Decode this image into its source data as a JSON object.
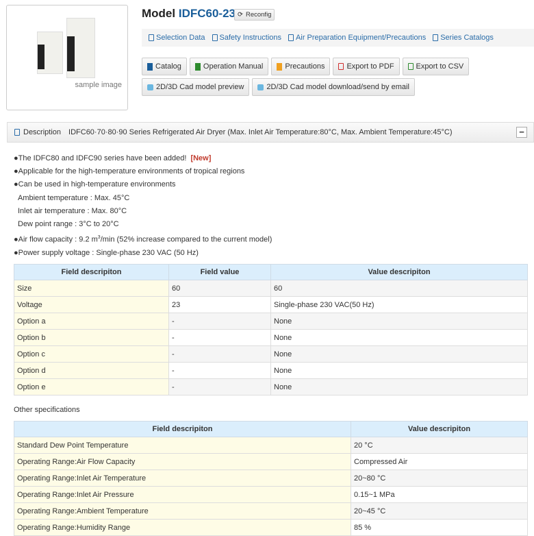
{
  "image": {
    "caption": "sample image"
  },
  "header": {
    "prefix": "Model",
    "model": "IDFC60-23",
    "reconfig": "Reconfig"
  },
  "links": [
    "Selection Data",
    "Safety Instructions",
    "Air Preparation Equipment/Precautions",
    "Series Catalogs"
  ],
  "buttons": {
    "catalog": "Catalog",
    "manual": "Operation Manual",
    "precautions": "Precautions",
    "pdf": "Export to PDF",
    "csv": "Export to CSV",
    "cad_preview": "2D/3D Cad model preview",
    "cad_download": "2D/3D Cad model download/send by email"
  },
  "colors": {
    "catalog": "#1a5e9a",
    "manual": "#2e8b2e",
    "precautions": "#f0a020",
    "pdf": "#d03030",
    "csv": "#2e8b2e"
  },
  "description": {
    "label": "Description",
    "text": "IDFC60·70·80·90 Series Refrigerated Air Dryer (Max. Inlet Air Temperature:80°C, Max. Ambient Temperature:45°C)",
    "collapse": "−",
    "line1": "●The IDFC80 and IDFC90 series have been added!",
    "new_badge": "[New]",
    "line2": "●Applicable for the high-temperature environments of tropical regions",
    "line3": "●Can be used in high-temperature environments",
    "line4": "Ambient temperature : Max. 45°C",
    "line5": "Inlet air temperature : Max. 80°C",
    "line6": "Dew point range : 3°C to 20°C",
    "line7a": "●Air flow capacity : 9.2 m",
    "line7sup": "3",
    "line7b": "/min (52% increase compared to the current model)",
    "line8": "●Power supply voltage : Single-phase 230 VAC (50 Hz)"
  },
  "table1": {
    "headers": [
      "Field descripiton",
      "Field value",
      "Value descripiton"
    ],
    "rows": [
      [
        "Size",
        "60",
        "60"
      ],
      [
        "Voltage",
        "23",
        "Single-phase 230 VAC(50 Hz)"
      ],
      [
        "Option a",
        "-",
        "None"
      ],
      [
        "Option b",
        "-",
        "None"
      ],
      [
        "Option c",
        "-",
        "None"
      ],
      [
        "Option d",
        "-",
        "None"
      ],
      [
        "Option e",
        "-",
        "None"
      ]
    ]
  },
  "other_title": "Other specifications",
  "table2": {
    "headers": [
      "Field descripiton",
      "Value descripiton"
    ],
    "rows": [
      [
        "Standard Dew Point Temperature",
        "20 °C"
      ],
      [
        "Operating Range:Air Flow Capacity",
        "Compressed Air"
      ],
      [
        "Operating Range:Inlet Air Temperature",
        "20~80 °C"
      ],
      [
        "Operating Range:Inlet Air Pressure",
        "0.15~1 MPa"
      ],
      [
        "Operating Range:Ambient Temperature",
        "20~45 °C"
      ],
      [
        "Operating Range:Humidity Range",
        "85 %"
      ]
    ]
  }
}
